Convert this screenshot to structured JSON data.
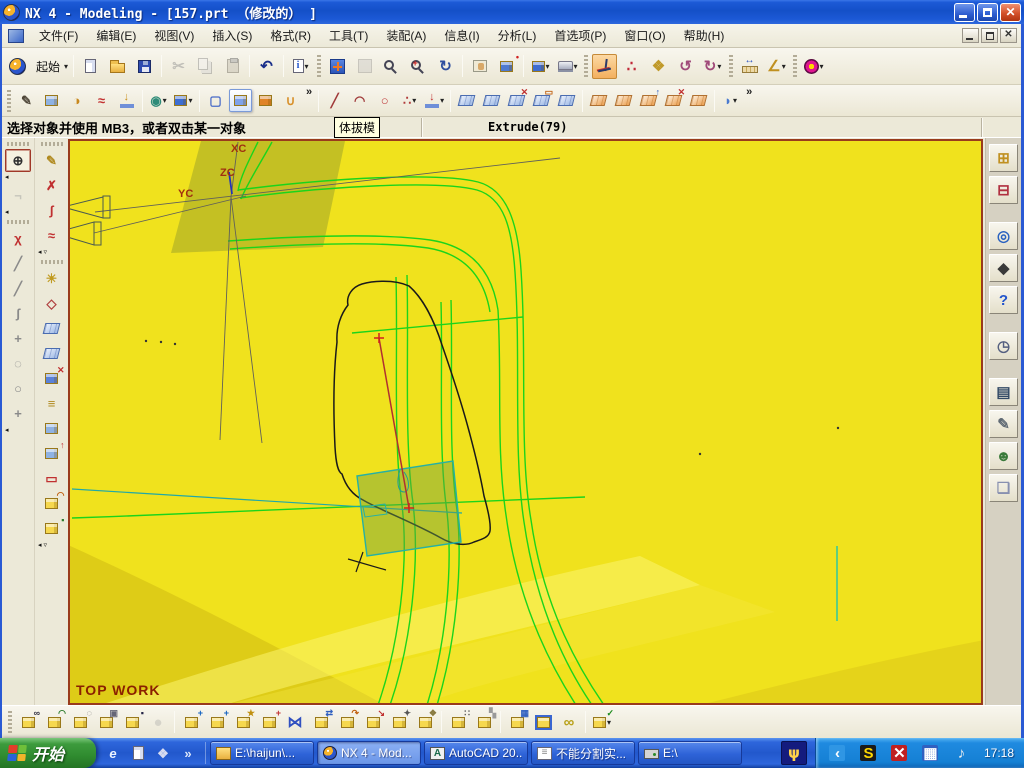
{
  "window": {
    "title": "NX 4 - Modeling - [157.prt （修改的） ]",
    "controls": [
      "minimize",
      "restore",
      "close"
    ]
  },
  "menu_bar": {
    "items": [
      "文件(F)",
      "编辑(E)",
      "视图(V)",
      "插入(S)",
      "格式(R)",
      "工具(T)",
      "装配(A)",
      "信息(I)",
      "分析(L)",
      "首选项(P)",
      "窗口(O)",
      "帮助(H)"
    ]
  },
  "toolbar1": {
    "items": [
      {
        "n": "nx-logo",
        "t": "logo"
      },
      {
        "n": "start-roles",
        "label": "起始",
        "dd": 1
      },
      {
        "sep": 1
      },
      {
        "n": "new-file",
        "t": "doc"
      },
      {
        "n": "open-file",
        "t": "folder"
      },
      {
        "n": "save-file",
        "t": "disk"
      },
      {
        "sep": 1
      },
      {
        "n": "cut",
        "g": "✂",
        "c": "#8a8a8a",
        "dis": 1
      },
      {
        "n": "copy",
        "t": "copy",
        "dis": 1
      },
      {
        "n": "paste",
        "t": "paste",
        "dis": 1
      },
      {
        "sep": 1
      },
      {
        "n": "undo",
        "g": "↶",
        "c": "#1a2f8a"
      },
      {
        "sep": 1
      },
      {
        "n": "object-info",
        "t": "infodoc",
        "dd": 1
      },
      {
        "grip": 1
      },
      {
        "n": "fit-view",
        "t": "fit"
      },
      {
        "n": "zoom-window",
        "t": "zoomgray",
        "dis": 1
      },
      {
        "n": "zoom-lasso",
        "t": "mag"
      },
      {
        "n": "zoom-in-out",
        "t": "magpm"
      },
      {
        "n": "rotate-view",
        "g": "↻",
        "c": "#2f4f9f"
      },
      {
        "sep": 1
      },
      {
        "n": "pan-view",
        "t": "pan"
      },
      {
        "n": "perspective-view",
        "t": "cube",
        "cc": "#4f7ad0",
        "o": "•",
        "oc": "#d02020"
      },
      {
        "sep": 1
      },
      {
        "n": "view-orientation",
        "t": "cube",
        "cc": "#3f6cd0",
        "dd": 1
      },
      {
        "n": "visual-effects",
        "t": "laptop",
        "dd": 1
      },
      {
        "grip": 1
      },
      {
        "n": "wcs-dynamics",
        "t": "csys",
        "active": 1
      },
      {
        "n": "point-set",
        "g": "∴",
        "c": "#c02838"
      },
      {
        "n": "snapshot",
        "g": "❖",
        "c": "#c09a2a"
      },
      {
        "n": "rotate-left",
        "g": "↺",
        "c": "#a04a7a"
      },
      {
        "n": "rotate-right",
        "g": "↻",
        "c": "#a04a7a",
        "dd": 1
      },
      {
        "grip": 1
      },
      {
        "n": "measure-distance",
        "t": "ruler"
      },
      {
        "n": "measure-angle",
        "g": "∠",
        "c": "#c09020",
        "dd": 1
      },
      {
        "grip": 1
      },
      {
        "n": "user-roles",
        "t": "gear",
        "dd": 1
      }
    ]
  },
  "toolbar2": {
    "items": [
      {
        "grip": 1
      },
      {
        "n": "sketch",
        "g": "✎",
        "c": "#50483a"
      },
      {
        "n": "datum-plane",
        "t": "cube",
        "cc": "#8fb2e2"
      },
      {
        "n": "trim-body",
        "g": "◑",
        "c": "#c8881e"
      },
      {
        "n": "freeform-feature",
        "g": "≈",
        "c": "#c23030"
      },
      {
        "n": "table-feature",
        "t": "drop"
      },
      {
        "sep": 1
      },
      {
        "n": "boolean-operations",
        "g": "◉",
        "c": "#2e8b78",
        "dd": 1
      },
      {
        "n": "solid-body",
        "t": "cube",
        "cc": "#3e6ed2",
        "dd": 1
      },
      {
        "sep": 1
      },
      {
        "n": "wireframe-display",
        "g": "▢",
        "c": "#4a6cc8"
      },
      {
        "n": "shaded-display",
        "t": "cube",
        "cc": "#7fa2ea",
        "hover": 1
      },
      {
        "n": "section-view",
        "t": "cube",
        "cc": "#e08428"
      },
      {
        "n": "sheet-bend",
        "g": "∪",
        "c": "#d8902a"
      },
      {
        "ovf": 1
      },
      {
        "sep": 1
      },
      {
        "n": "line",
        "g": "╱",
        "c": "#a03a3a"
      },
      {
        "n": "arc",
        "g": "◠",
        "c": "#a03a3a"
      },
      {
        "n": "profile-curve",
        "g": "○",
        "c": "#c04040"
      },
      {
        "n": "point-tool",
        "g": "∴",
        "c": "#b03a3a",
        "dd": 1
      },
      {
        "n": "extrude",
        "t": "drop2",
        "dd": 1
      },
      {
        "sep": 1
      },
      {
        "n": "through-curves",
        "t": "sheet"
      },
      {
        "n": "through-curve-mesh",
        "t": "sheet"
      },
      {
        "n": "studio-surface",
        "t": "sheet",
        "o": "✕",
        "oc": "#c03030"
      },
      {
        "n": "swept-surface",
        "t": "sheet",
        "o": "▭",
        "oc": "#c06010"
      },
      {
        "n": "section-surface",
        "t": "sheet"
      },
      {
        "sep": 1
      },
      {
        "n": "offset-surface",
        "t": "sheet2"
      },
      {
        "n": "thicken-sheet",
        "t": "sheet2"
      },
      {
        "n": "sew-sheet",
        "t": "sheet2",
        "o": "↑",
        "oc": "#3060c0"
      },
      {
        "n": "patch-sheet",
        "t": "sheet2",
        "o": "✕",
        "oc": "#c03030"
      },
      {
        "n": "trim-sheet",
        "t": "sheet2"
      },
      {
        "sep": 1
      },
      {
        "n": "more-shape-tools",
        "g": "◗",
        "c": "#4a7ad0",
        "dd": 1
      },
      {
        "ovf": 1
      }
    ]
  },
  "prompt_bar": {
    "message": "选择对象并使用 MB3，或者双击某一对象",
    "tooltip": "体拔模",
    "status": "Extrude(79)"
  },
  "left_toolbar_col1": {
    "items": [
      {
        "grip": 1
      },
      {
        "n": "point-constructor",
        "g": "⊕",
        "c": "#303030",
        "sel": 1
      },
      {
        "fly": "l"
      },
      {
        "n": "tube-tool",
        "g": "¬",
        "c": "#9a9a9a",
        "dis": 1
      },
      {
        "fly": "l"
      },
      {
        "grip": 1
      },
      {
        "n": "curve-chamfer",
        "g": "χ",
        "c": "#c03030"
      },
      {
        "n": "basic-line",
        "g": "╱",
        "c": "#8a8a8a"
      },
      {
        "n": "associative-line",
        "g": "╱",
        "c": "#8a8a8a"
      },
      {
        "n": "spline",
        "g": "ʃ",
        "c": "#8a8a8a"
      },
      {
        "n": "point-on-curve",
        "g": "+",
        "c": "#8a8a8a"
      },
      {
        "n": "arc-tool",
        "g": "◌",
        "c": "#8a8a8a"
      },
      {
        "n": "circle-tool",
        "g": "○",
        "c": "#8a8a8a"
      },
      {
        "n": "plus-point",
        "g": "+",
        "c": "#8a8a8a"
      },
      {
        "fly": "l"
      }
    ]
  },
  "left_toolbar_col2": {
    "items": [
      {
        "grip": 1
      },
      {
        "n": "edit-curve-parameters",
        "g": "✎",
        "c": "#b08a20"
      },
      {
        "n": "trim-curve",
        "g": "✗",
        "c": "#c03030"
      },
      {
        "n": "bridge-curve",
        "g": "ʃ",
        "c": "#c03030"
      },
      {
        "n": "smooth-spline",
        "g": "≈",
        "c": "#c03030"
      },
      {
        "fly": "ld"
      },
      {
        "grip": 1
      },
      {
        "n": "studio-surface-tool",
        "g": "☀",
        "c": "#c09a20"
      },
      {
        "n": "bounded-plane",
        "g": "◇",
        "c": "#b04040"
      },
      {
        "n": "through-curves-tool",
        "t": "sheet"
      },
      {
        "n": "curve-mesh-tool",
        "t": "sheet"
      },
      {
        "n": "trimmed-sheet",
        "t": "cube",
        "cc": "#5b82d8",
        "o": "✕",
        "oc": "#c03030"
      },
      {
        "n": "pattern-feature",
        "g": "≡",
        "c": "#b08a20"
      },
      {
        "n": "flange",
        "t": "cube",
        "cc": "#8fb2e2"
      },
      {
        "n": "tube-feature",
        "t": "cube",
        "cc": "#8fb2e2",
        "o": "↑",
        "oc": "#c03030"
      },
      {
        "n": "emboss",
        "g": "▭",
        "c": "#c03030"
      },
      {
        "n": "boss",
        "t": "cube",
        "o": "◠",
        "oc": "#c06010"
      },
      {
        "n": "pad",
        "t": "cube",
        "o": "▪",
        "oc": "#2a7a2a"
      },
      {
        "fly": "ld"
      }
    ]
  },
  "right_sidebar": {
    "items": [
      {
        "n": "assembly-navigator",
        "g": "⊞",
        "c": "#c09020"
      },
      {
        "n": "part-navigator",
        "g": "⊟",
        "c": "#b03040"
      },
      {
        "gap": 1
      },
      {
        "n": "web-browser",
        "g": "◎",
        "c": "#2a62c0"
      },
      {
        "n": "tutorials",
        "g": "◆",
        "c": "#3a3a3a"
      },
      {
        "n": "help",
        "g": "?",
        "c": "#2255cc"
      },
      {
        "gap": 1
      },
      {
        "n": "history",
        "g": "◷",
        "c": "#556080"
      },
      {
        "gap": 1
      },
      {
        "n": "materials-palette",
        "g": "▤",
        "c": "#334a66"
      },
      {
        "n": "customize-tools",
        "g": "✎",
        "c": "#606a74"
      },
      {
        "n": "collaboration",
        "g": "☻",
        "c": "#3a7a3a"
      },
      {
        "n": "new-window",
        "g": "❏",
        "c": "#8890b0"
      }
    ]
  },
  "bottom_toolbar": {
    "items": [
      {
        "grip": 1
      },
      {
        "n": "find-component",
        "t": "cube",
        "o": "∞",
        "oc": "#334"
      },
      {
        "n": "open-component",
        "t": "cube",
        "o": "◠",
        "oc": "#2a7a2a"
      },
      {
        "n": "select-components",
        "t": "cube",
        "o": "◌",
        "oc": "#555"
      },
      {
        "n": "component-set",
        "t": "cube",
        "o": "▣",
        "oc": "#667"
      },
      {
        "n": "save-component-view",
        "t": "cube",
        "o": "▪",
        "oc": "#224"
      },
      {
        "n": "inactive-tool",
        "g": "●",
        "c": "#b8b4a4",
        "dis": 1
      },
      {
        "sep": 1
      },
      {
        "n": "add-existing-component",
        "t": "cube",
        "o": "+",
        "oc": "#1060c0"
      },
      {
        "n": "create-new-component",
        "t": "cube",
        "o": "+",
        "oc": "#1060c0"
      },
      {
        "n": "create-component-array",
        "t": "cube",
        "o": "★",
        "oc": "#c09010"
      },
      {
        "n": "pattern-component",
        "t": "cube",
        "o": "+",
        "oc": "#c03030"
      },
      {
        "n": "mirror-assembly",
        "g": "⋈",
        "c": "#3050c0"
      },
      {
        "n": "move-component",
        "t": "cube",
        "o": "⇄",
        "oc": "#3060c0"
      },
      {
        "n": "replace-component",
        "t": "cube",
        "o": "↷",
        "oc": "#c06010"
      },
      {
        "n": "reposition-component",
        "t": "cube",
        "o": "↘",
        "oc": "#c03030"
      },
      {
        "n": "assembly-constraints",
        "t": "cube",
        "o": "✦",
        "oc": "#555"
      },
      {
        "n": "arrangements",
        "t": "cube",
        "o": "❖",
        "oc": "#887a40"
      },
      {
        "sep": 1
      },
      {
        "n": "component-group",
        "t": "cube",
        "o": "∷",
        "oc": "#555"
      },
      {
        "n": "promote-body",
        "t": "cube",
        "o": "▚",
        "oc": "#999"
      },
      {
        "sep": 1
      },
      {
        "n": "wave-geometry-linker",
        "t": "cube",
        "o": "▦",
        "oc": "#3060c0"
      },
      {
        "n": "wave-link",
        "t": "cubeframe"
      },
      {
        "n": "interpart-links",
        "g": "∞",
        "c": "#b8a018"
      },
      {
        "sep": 1
      },
      {
        "n": "check-structure",
        "t": "cube",
        "o": "✓",
        "oc": "#1a8a1a",
        "dd": 1
      }
    ]
  },
  "viewport": {
    "label": "TOP WORK",
    "axis_labels": {
      "xc": "XC",
      "yc": "YC",
      "zc": "ZC"
    },
    "colors": {
      "background": "#f0e21d",
      "border": "#993b1c",
      "curve_green": "#1bd41b",
      "sketch_black": "#1a1a1a",
      "marker_red": "#c03030",
      "plane_teal": "#25b0a5",
      "wcs_blue": "#2233bb",
      "axis_label_red": "#a03010"
    }
  },
  "taskbar": {
    "start_label": "开始",
    "quick_launch": [
      {
        "n": "internet-explorer",
        "g": "e",
        "c": "#eaf2ff",
        "it": 1
      },
      {
        "n": "show-desktop",
        "t": "doc"
      },
      {
        "n": "media-shortcut",
        "g": "❖",
        "c": "#d8dcf0"
      },
      {
        "n": "quick-launch-overflow",
        "g": "»",
        "c": "#dce6fa"
      }
    ],
    "tasks": [
      {
        "n": "task-explorer",
        "icon": "folder",
        "label": "E:\\haijun\\..."
      },
      {
        "n": "task-nx",
        "icon": "nx",
        "label": "NX 4 - Mod...",
        "active": 1
      },
      {
        "n": "task-autocad",
        "icon": "acad",
        "label": "AutoCAD 20..."
      },
      {
        "n": "task-notepad",
        "icon": "note",
        "label": "不能分割实..."
      },
      {
        "n": "task-drive",
        "icon": "drive",
        "label": "E:\\"
      }
    ],
    "trident_glyph": "ψ",
    "tray": {
      "icons": [
        {
          "n": "tray-collapse",
          "g": "‹",
          "c": "#ffffff",
          "bg": "#2f96e4"
        },
        {
          "n": "tray-input-tool",
          "g": "S",
          "c": "#ffd700",
          "bg": "#1a1a1a"
        },
        {
          "n": "tray-alert",
          "g": "✕",
          "c": "#ffffff",
          "bg": "#c02020"
        },
        {
          "n": "tray-display",
          "g": "▦",
          "c": "#ffffff",
          "bg": "#3060c0"
        },
        {
          "n": "tray-volume",
          "g": "♪",
          "c": "#eeeeee",
          "bg": "transparent"
        }
      ],
      "time": "17:18"
    }
  },
  "colors": {
    "titlebar_blue": "#1c59d6",
    "taskbar_blue": "#2258cc",
    "start_green": "#2f8b2f",
    "toolbar_beige": "#ece9d8",
    "highlight_orange": "#f3b05e"
  }
}
